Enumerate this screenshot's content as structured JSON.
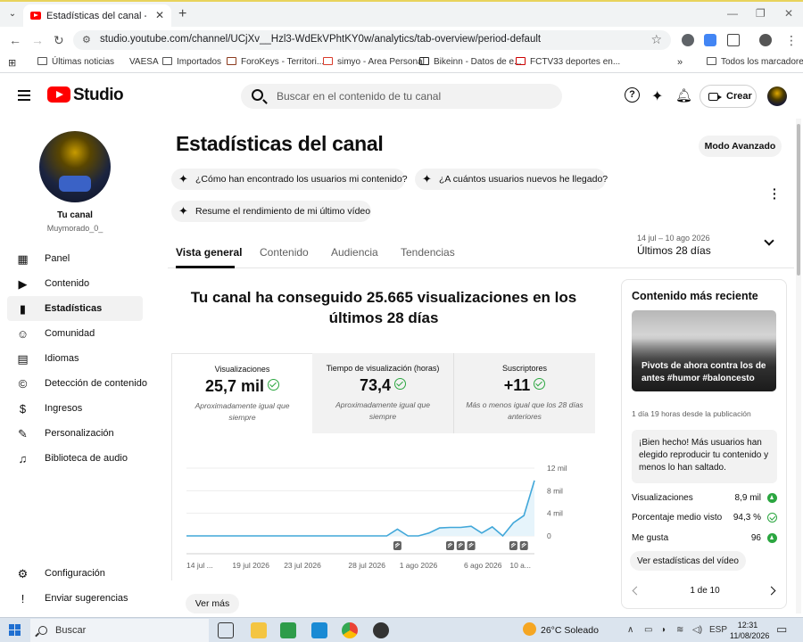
{
  "browser": {
    "tab_title": "Estadísticas del canal - YouTube Studio",
    "url": "studio.youtube.com/channel/UCjXv__Hzl3-WdEkVPhtKY0w/analytics/tab-overview/period-default",
    "bookmarks": [
      "Últimas noticias",
      "VAESA",
      "Importados",
      "ForoKeys - Territori...",
      "simyo - Area Personal",
      "Bikeinn - Datos de e...",
      "FCTV33 deportes en...",
      "Todos los marcadores"
    ]
  },
  "header": {
    "logo_text": "Studio",
    "search_placeholder": "Buscar en el contenido de tu canal",
    "create_label": "Crear"
  },
  "sidebar": {
    "channel_name": "Tu canal",
    "channel_handle": "Muymorado_0_",
    "items": [
      {
        "label": "Panel",
        "icon": "dashboard-icon"
      },
      {
        "label": "Contenido",
        "icon": "content-icon"
      },
      {
        "label": "Estadísticas",
        "icon": "analytics-icon",
        "active": true
      },
      {
        "label": "Comunidad",
        "icon": "community-icon"
      },
      {
        "label": "Idiomas",
        "icon": "subtitles-icon"
      },
      {
        "label": "Detección de contenido",
        "icon": "copyright-icon"
      },
      {
        "label": "Ingresos",
        "icon": "dollar-icon"
      },
      {
        "label": "Personalización",
        "icon": "magic-wand-icon"
      },
      {
        "label": "Biblioteca de audio",
        "icon": "audio-library-icon"
      }
    ],
    "bottom_items": [
      {
        "label": "Configuración",
        "icon": "gear-icon"
      },
      {
        "label": "Enviar sugerencias",
        "icon": "feedback-icon"
      }
    ]
  },
  "main": {
    "title": "Estadísticas del canal",
    "advanced_mode": "Modo Avanzado",
    "chips": [
      "¿Cómo han encontrado los usuarios mi contenido?",
      "¿A cuántos usuarios nuevos he llegado?",
      "Resume el rendimiento de mi último vídeo"
    ],
    "tabs": [
      "Vista general",
      "Contenido",
      "Audiencia",
      "Tendencias"
    ],
    "period_range": "14 jul – 10 ago 2026",
    "period_label": "Últimos 28 días",
    "headline": "Tu canal ha conseguido 25.665 visualizaciones en los últimos 28 días",
    "metrics": [
      {
        "label": "Visualizaciones",
        "value": "25,7 mil",
        "sub": "Aproximadamente igual que siempre"
      },
      {
        "label": "Tiempo de visualización (horas)",
        "value": "73,4",
        "sub": "Aproximadamente igual que siempre"
      },
      {
        "label": "Suscriptores",
        "value": "+11",
        "sub": "Más o menos igual que los 28 días anteriores"
      }
    ],
    "see_more": "Ver más"
  },
  "chart_data": {
    "type": "line",
    "x_tick_labels": [
      "14 jul ...",
      "19 jul 2026",
      "23 jul 2026",
      "28 jul 2026",
      "1 ago 2026",
      "6 ago 2026",
      "10 a..."
    ],
    "y_tick_labels": [
      "12 mil",
      "8 mil",
      "4 mil",
      "0"
    ],
    "ylim": [
      0,
      12000
    ],
    "series": [
      {
        "values": [
          0,
          0,
          0,
          0,
          0,
          0,
          0,
          0,
          0,
          0,
          0,
          0,
          0,
          0,
          0,
          0,
          0,
          0,
          0,
          0,
          1200,
          0,
          0,
          500,
          1400,
          1500,
          1500,
          1700,
          500,
          1600,
          0,
          2300,
          3600,
          9800
        ]
      }
    ],
    "video_markers": 6,
    "grid": true,
    "line_color": "#41a7d9",
    "area_color": "#e6f4fb"
  },
  "recent_content": {
    "title": "Contenido más reciente",
    "video_title": "Pivots de ahora contra los de antes #humor #baloncesto",
    "published": "1 día 19 horas desde la publicación",
    "message": "¡Bien hecho! Más usuarios han elegido reproducir tu contenido y menos lo han saltado.",
    "stats": [
      {
        "label": "Visualizaciones",
        "value": "8,9 mil",
        "indicator": "up"
      },
      {
        "label": "Porcentaje medio visto",
        "value": "94,3 %",
        "indicator": "ok"
      },
      {
        "label": "Me gusta",
        "value": "96",
        "indicator": "up"
      }
    ],
    "button": "Ver estadísticas del vídeo",
    "pager": "1 de 10"
  },
  "taskbar": {
    "search": "Buscar",
    "weather": "26°C  Soleado",
    "lang": "ESP",
    "time": "12:31",
    "date": "11/08/2026"
  }
}
